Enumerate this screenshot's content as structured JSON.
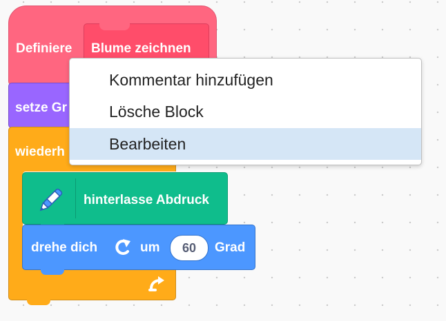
{
  "define_block": {
    "keyword": "Definiere",
    "name": "Blume zeichnen"
  },
  "set_block": {
    "label_visible": "setze Gr"
  },
  "repeat_block": {
    "label_visible": "wiederh"
  },
  "pen_block": {
    "label": "hinterlasse Abdruck",
    "icon": "pen-icon"
  },
  "turn_block": {
    "label": "drehe dich",
    "icon": "rotate-right-icon",
    "um": "um",
    "degrees": "60",
    "unit": "Grad"
  },
  "context_menu": {
    "items": [
      {
        "label": "Kommentar hinzufügen"
      },
      {
        "label": "Lösche Block"
      },
      {
        "label": "Bearbeiten",
        "highlighted": true
      }
    ]
  },
  "colors": {
    "define": "#ff6680",
    "looks_purple": "#9966ff",
    "control_orange": "#ffab19",
    "pen_green": "#0fbd8c",
    "motion_blue": "#4c97ff",
    "menu_highlight": "#d5e6f6"
  }
}
